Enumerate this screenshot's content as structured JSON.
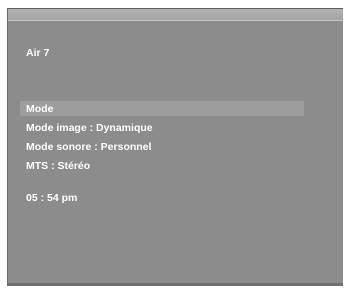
{
  "osd": {
    "channel": "Air  7",
    "mode": "Mode",
    "picture_mode": "Mode image : Dynamique",
    "sound_mode": "Mode sonore : Personnel",
    "mts": "MTS : Stéréo",
    "time": "05 : 54 pm"
  },
  "colors": {
    "screen_background": "#8c8c8c",
    "highlight": "#9d9d9d",
    "text": "#ffffff"
  }
}
